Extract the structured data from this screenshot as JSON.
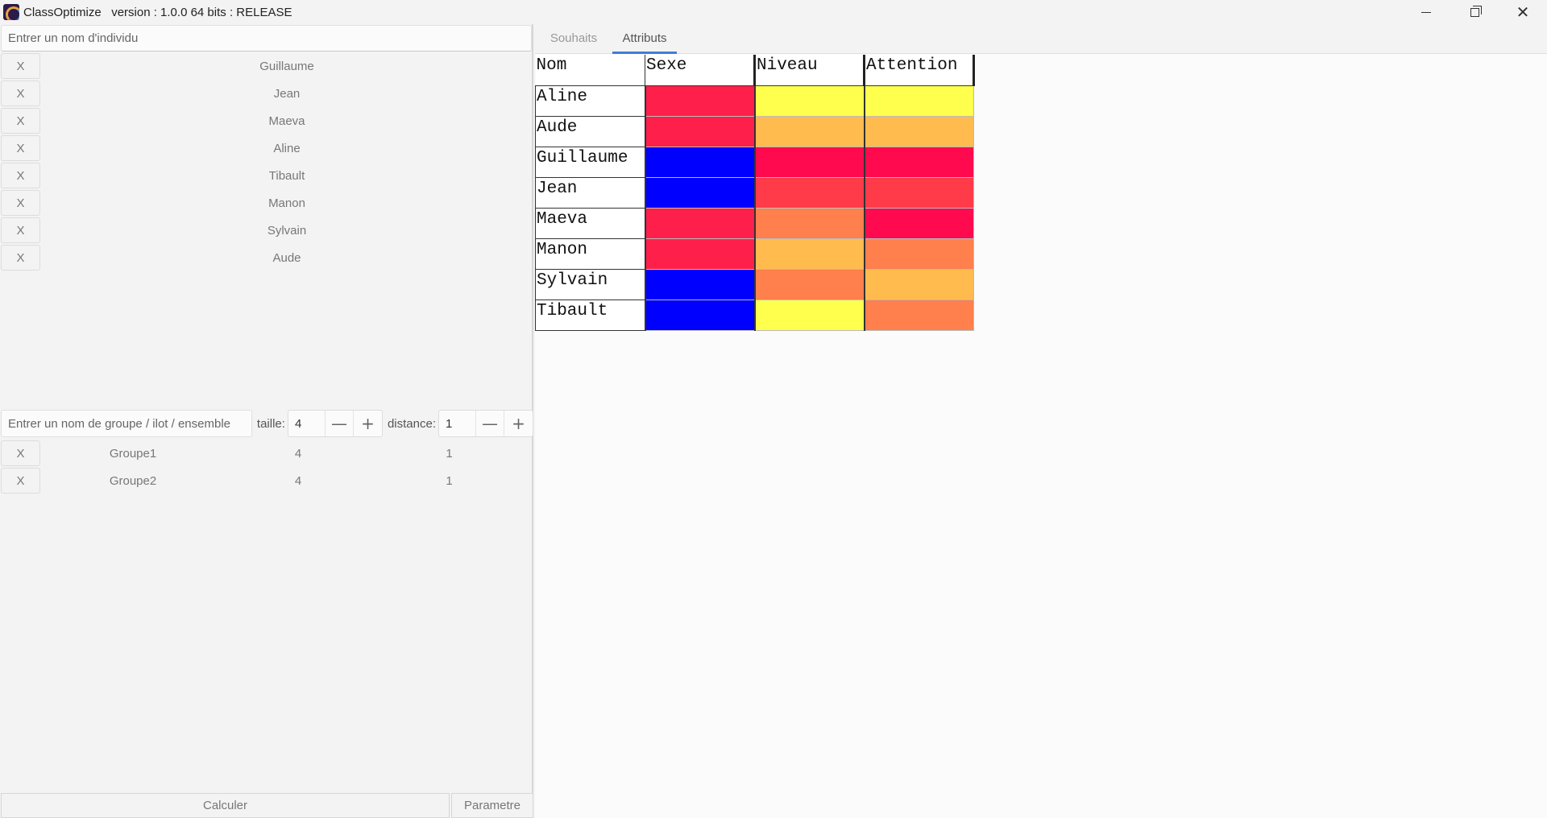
{
  "window": {
    "title": "ClassOptimize   version : 1.0.0 64 bits : RELEASE",
    "controls": {
      "minimize": "minimize",
      "maximize": "maximize",
      "close": "close"
    }
  },
  "individus": {
    "placeholder": "Entrer un nom d'individu",
    "remove_label": "X",
    "items": [
      {
        "name": "Guillaume"
      },
      {
        "name": "Jean"
      },
      {
        "name": "Maeva"
      },
      {
        "name": "Aline"
      },
      {
        "name": "Tibault"
      },
      {
        "name": "Manon"
      },
      {
        "name": "Sylvain"
      },
      {
        "name": "Aude"
      }
    ]
  },
  "groupes": {
    "placeholder": "Entrer un nom de groupe / ilot / ensemble",
    "taille_label": "taille:",
    "taille_value": "4",
    "distance_label": "distance:",
    "distance_value": "1",
    "minus_glyph": "—",
    "plus_glyph": "+",
    "remove_label": "X",
    "items": [
      {
        "name": "Groupe1",
        "taille": "4",
        "distance": "1"
      },
      {
        "name": "Groupe2",
        "taille": "4",
        "distance": "1"
      }
    ]
  },
  "buttons": {
    "calculer": "Calculer",
    "parametre": "Parametre"
  },
  "tabs": {
    "souhaits": "Souhaits",
    "attributs": "Attributs"
  },
  "colors": {
    "accent": "#3d7fd8",
    "pink": "#fe1f4b",
    "blue": "#0000fe",
    "yellow": "#ffff4d",
    "light_orange": "#ffbb4d",
    "crimson": "#ff0a4f",
    "red_orange": "#ff3b4a",
    "orange": "#ff7f4d"
  },
  "attributs": {
    "headers": [
      "Nom",
      "Sexe",
      "Niveau",
      "Attention"
    ],
    "rows": [
      {
        "nom": "Aline",
        "colors": [
          "#fe1f4b",
          "#ffff4d",
          "#ffff4d"
        ]
      },
      {
        "nom": "Aude",
        "colors": [
          "#fe1f4b",
          "#ffbb4d",
          "#ffbb4d"
        ]
      },
      {
        "nom": "Guillaume",
        "colors": [
          "#0000fe",
          "#ff0a4f",
          "#ff0a4f"
        ]
      },
      {
        "nom": "Jean",
        "colors": [
          "#0000fe",
          "#ff3b4a",
          "#ff3b4a"
        ]
      },
      {
        "nom": "Maeva",
        "colors": [
          "#fe1f4b",
          "#ff7f4d",
          "#ff0a4f"
        ]
      },
      {
        "nom": "Manon",
        "colors": [
          "#fe1f4b",
          "#ffbb4d",
          "#ff7f4d"
        ]
      },
      {
        "nom": "Sylvain",
        "colors": [
          "#0000fe",
          "#ff7f4d",
          "#ffbb4d"
        ]
      },
      {
        "nom": "Tibault",
        "colors": [
          "#0000fe",
          "#ffff4d",
          "#ff7f4d"
        ]
      }
    ]
  }
}
